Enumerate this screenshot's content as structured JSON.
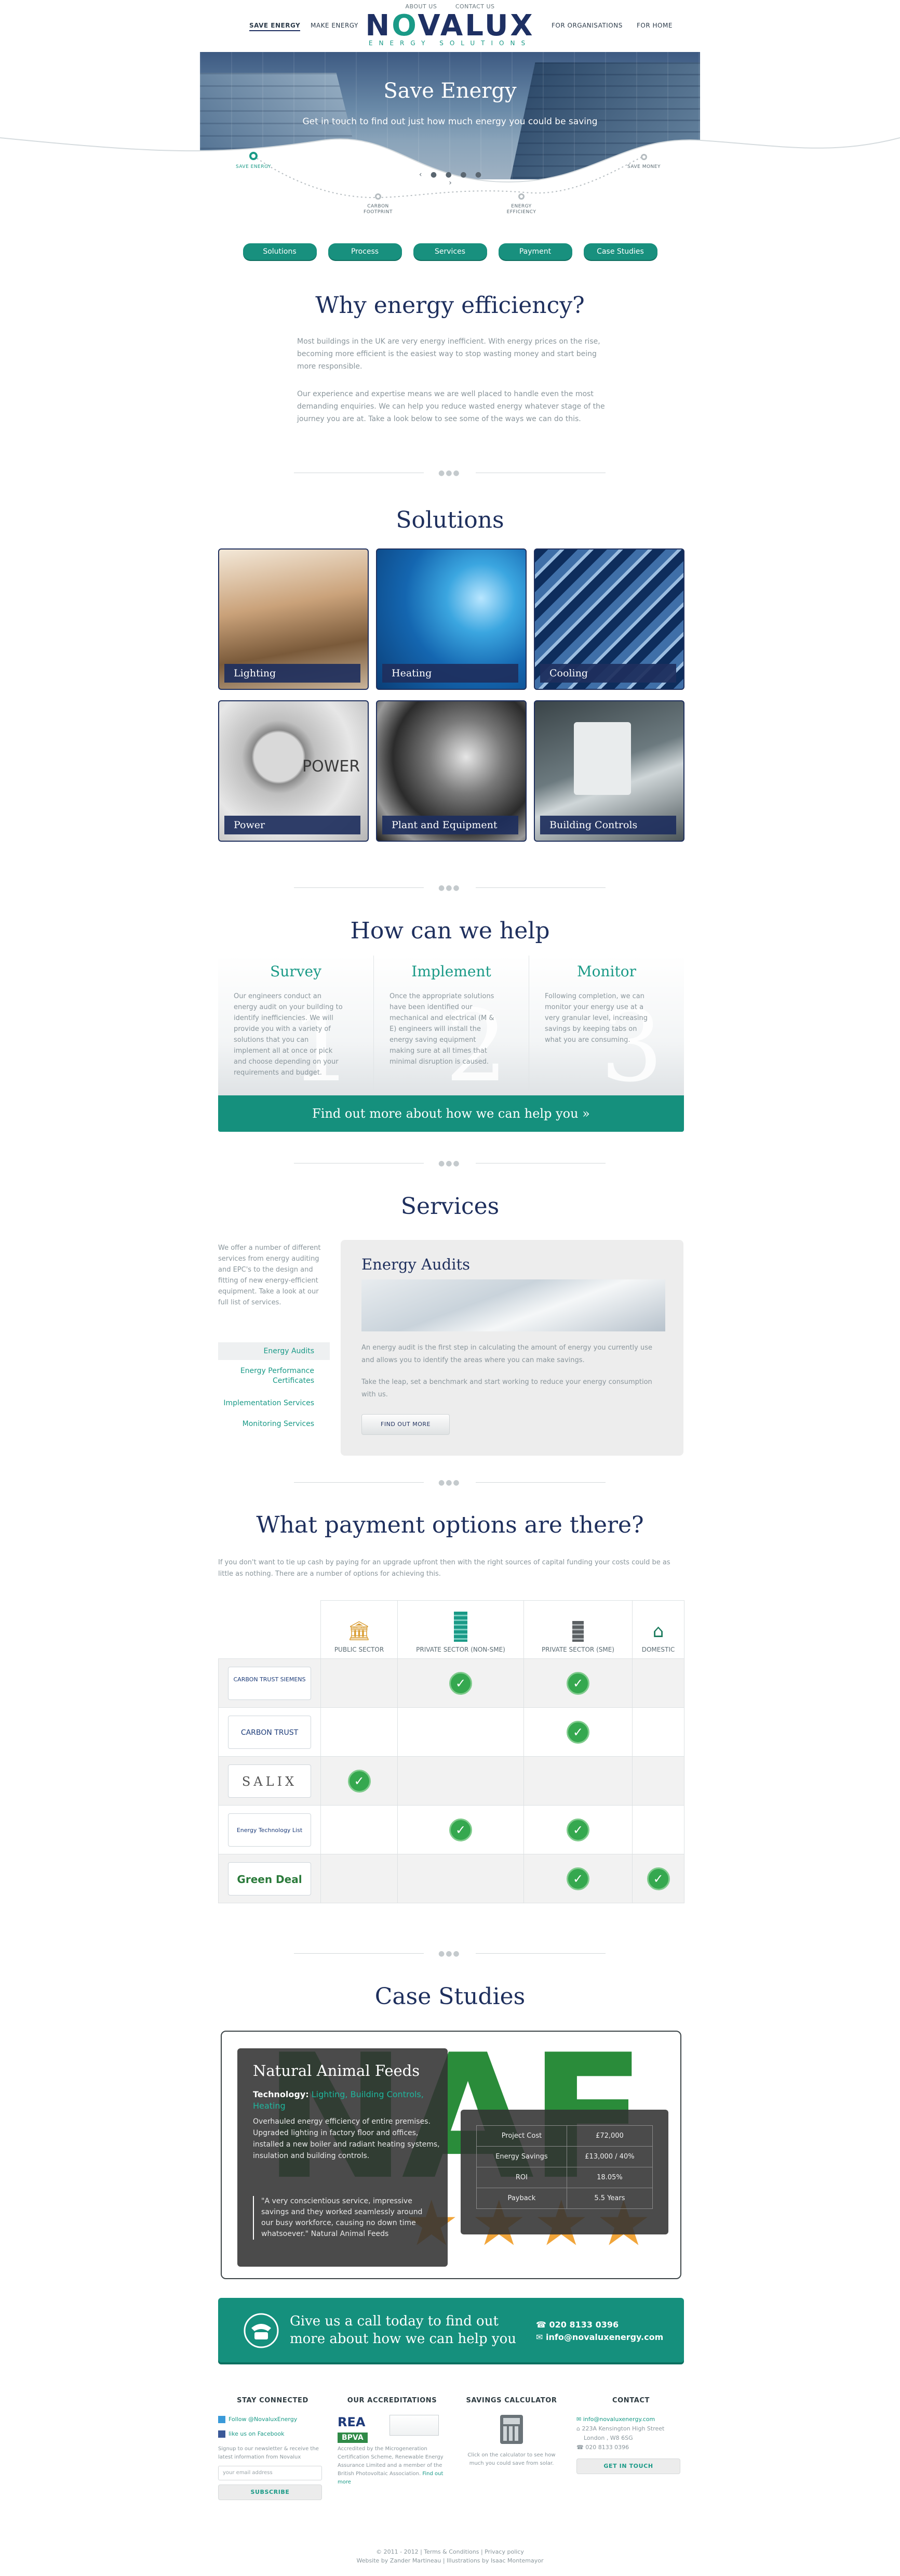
{
  "header": {
    "top_links": [
      "ABOUT US",
      "CONTACT US"
    ],
    "nav_left": [
      "SAVE ENERGY",
      "MAKE ENERGY"
    ],
    "nav_right": [
      "FOR ORGANISATIONS",
      "FOR HOME"
    ],
    "logo_pre": "N",
    "logo_o": "O",
    "logo_post": "VALUX",
    "logo_tag": "ENERGY SOLUTIONS"
  },
  "hero": {
    "title": "Save Energy",
    "subtitle": "Get in touch to find out just how much energy you could be saving",
    "steps": [
      "SAVE ENERGY",
      "CARBON FOOTPRINT",
      "ENERGY EFFICIENCY",
      "SAVE MONEY"
    ],
    "controls": "‹ ● ● ● ● ›"
  },
  "tabs": [
    "Solutions",
    "Process",
    "Services",
    "Payment",
    "Case Studies"
  ],
  "why": {
    "title": "Why energy efficiency?",
    "p1": "Most buildings in the UK are very energy inefficient. With energy prices on the rise, becoming more efficient is the easiest way to stop wasting money and start being more responsible.",
    "p2": "Our experience and expertise means we are well placed to handle even the most demanding enquiries.  We can help you reduce wasted energy whatever stage of the journey you are at. Take a look below to see some of the ways we can do this."
  },
  "solutions": {
    "title": "Solutions",
    "items": [
      "Lighting",
      "Heating",
      "Cooling",
      "Power",
      "Plant and Equipment",
      "Building Controls"
    ]
  },
  "help": {
    "title": "How can we help",
    "cols": [
      {
        "title": "Survey",
        "num": "1",
        "text": "Our engineers conduct an energy audit on your building to identify inefficiencies. We will provide you with a variety of solutions that you can implement all at once or pick and choose depending on your requirements and budget."
      },
      {
        "title": "Implement",
        "num": "2",
        "text": "Once the appropriate solutions have been identified our mechanical and electrical (M & E) engineers will install the energy saving equipment making sure at all times that minimal disruption is caused."
      },
      {
        "title": "Monitor",
        "num": "3",
        "text": "Following completion, we can monitor your energy use at a very granular level, increasing savings by keeping tabs on what you are consuming."
      }
    ],
    "cta": "Find out more about how we can help you »"
  },
  "services": {
    "title": "Services",
    "intro": "We offer a number of different services from energy auditing and EPC's to the design and fitting of new energy-efficient equipment. Take a look at our full list of services.",
    "nav": [
      "Energy Audits",
      "Energy Performance Certificates",
      "Implementation Services",
      "Monitoring Services"
    ],
    "panel_title": "Energy Audits",
    "panel_p1": "An energy audit is the first step in calculating the amount of energy you currently use and allows you to identify the areas where you can make savings.",
    "panel_p2": "Take the leap, set a benchmark and start working to reduce your energy consumption with us.",
    "button": "FIND OUT MORE"
  },
  "payment": {
    "title": "What payment options are there?",
    "intro": "If you don't want to tie up cash by paying for an upgrade upfront then with the right sources of capital funding your costs could be as little as nothing. There are a number of options for achieving this.",
    "columns": [
      "PUBLIC SECTOR",
      "PRIVATE SECTOR (NON-SME)",
      "PRIVATE SECTOR (SME)",
      "DOMESTIC"
    ],
    "rows": [
      {
        "name": "CARBON TRUST  SIEMENS",
        "checks": [
          false,
          true,
          true,
          false
        ]
      },
      {
        "name": "CARBON TRUST",
        "checks": [
          false,
          false,
          true,
          false
        ]
      },
      {
        "name": "SALIX",
        "checks": [
          true,
          false,
          false,
          false
        ]
      },
      {
        "name": "Energy Technology List",
        "checks": [
          false,
          true,
          true,
          false
        ]
      },
      {
        "name": "Green Deal",
        "checks": [
          false,
          false,
          true,
          true
        ]
      }
    ]
  },
  "case": {
    "title": "Case Studies",
    "bg_letters": "NAF",
    "name": "Natural Animal Feeds",
    "tech_label": "Technology:",
    "tech": "Lighting, Building Controls, Heating",
    "body": "Overhauled energy efficiency of entire premises. Upgraded lighting in factory floor and offices, installed a new boiler and radiant heating systems, insulation and building controls.",
    "quote": "\"A very conscientious service, impressive savings and they worked seamlessly around our busy workforce, causing no down time whatsoever.\" Natural Animal Feeds",
    "stats": [
      [
        "Project Cost",
        "£72,000"
      ],
      [
        "Energy Savings",
        "£13,000 / 40%"
      ],
      [
        "ROI",
        "18.05%"
      ],
      [
        "Payback",
        "5.5 Years"
      ]
    ]
  },
  "cta": {
    "msg1": "Give us a call today to find out",
    "msg2": "more about how we can help you",
    "phone": "020 8133 0396",
    "email": "info@novaluxenergy.com"
  },
  "footer": {
    "connected": {
      "title": "STAY CONNECTED",
      "twitter": "Follow @NovaluxEnergy",
      "facebook": "like us on Facebook",
      "signup": "Signup to our newsletter & receive the latest information from Novalux",
      "placeholder": "your email address",
      "button": "SUBSCRIBE"
    },
    "accred": {
      "title": "OUR ACCREDITATIONS",
      "text": "Accredited by the Microgeneration Certification Scheme, Renewable Energy Assurance Limited and a member of the British Photovoltaic Association.",
      "link": "Find out more",
      "logos": [
        "REA",
        "BPVA"
      ]
    },
    "calc": {
      "title": "SAVINGS CALCULATOR",
      "text": "Click on the calculator to see how much you could save from solar."
    },
    "contact": {
      "title": "CONTACT",
      "email": "info@novaluxenergy.com",
      "addr1": "223A Kensington High Street",
      "addr2": "London , W8 6SG",
      "phone": "020 8133 0396",
      "button": "GET IN TOUCH"
    },
    "copy1": "© 2011 - 2012  |  Terms & Conditions  |  Privacy policy",
    "copy2": "Website by Zander Martineau  |  Illustrations by Isaac Montemayor"
  },
  "colors": {
    "navy": "#1e2f5d",
    "teal": "#1a9a87",
    "check_green": "#35a84f"
  }
}
